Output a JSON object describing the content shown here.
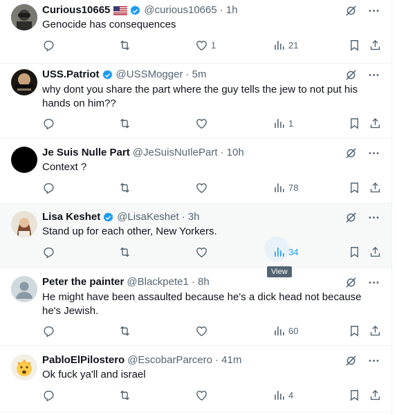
{
  "tweets": [
    {
      "name": "Curious10665",
      "verified": false,
      "flag": "us-flag",
      "handle": "@curious10665",
      "time": "· 1h",
      "text": "Genocide has consequences",
      "replies": "",
      "retweets": "",
      "likes": "1",
      "views": "21",
      "avatar_color": "#6b6b6b"
    },
    {
      "name": "USS.Patriot",
      "verified": true,
      "handle": "@USSMogger",
      "time": "· 5m",
      "text": "why dont you share the part where the guy tells the jew to not put his hands on him??",
      "replies": "",
      "retweets": "",
      "likes": "",
      "views": "1",
      "avatar_color": "#2a2218"
    },
    {
      "name": "Je Suis Nulle Part",
      "verified": false,
      "handle": "@JeSuisNuIlePart",
      "time": "· 10h",
      "text": "Context ?",
      "replies": "",
      "retweets": "",
      "likes": "",
      "views": "78",
      "avatar_color": "#000000"
    },
    {
      "name": "Lisa Keshet",
      "verified": true,
      "handle": "@LisaKeshet",
      "time": "· 3h",
      "text": "Stand up for each other, New Yorkers.",
      "replies": "",
      "retweets": "",
      "likes": "",
      "views": "34",
      "avatar_color": "#b89270",
      "hover": true,
      "tooltip": "View"
    },
    {
      "name": "Peter the painter",
      "verified": false,
      "handle": "@Blackpete1",
      "time": "· 8h",
      "text": "He might have been assaulted because he's a dick head not because he's Jewish.",
      "replies": "",
      "retweets": "",
      "likes": "",
      "views": "60",
      "avatar_color": "#cfd9de"
    },
    {
      "name": "PabloElPilostero",
      "verified": false,
      "handle": "@EscobarParcero",
      "time": "· 41m",
      "text": "Ok fuck ya'll and israel",
      "replies": "",
      "retweets": "",
      "likes": "",
      "views": "4",
      "avatar_color": "#ffe08a"
    }
  ],
  "colors": {
    "accent": "#1d9bf0",
    "muted": "#536471",
    "text": "#0f1419"
  }
}
